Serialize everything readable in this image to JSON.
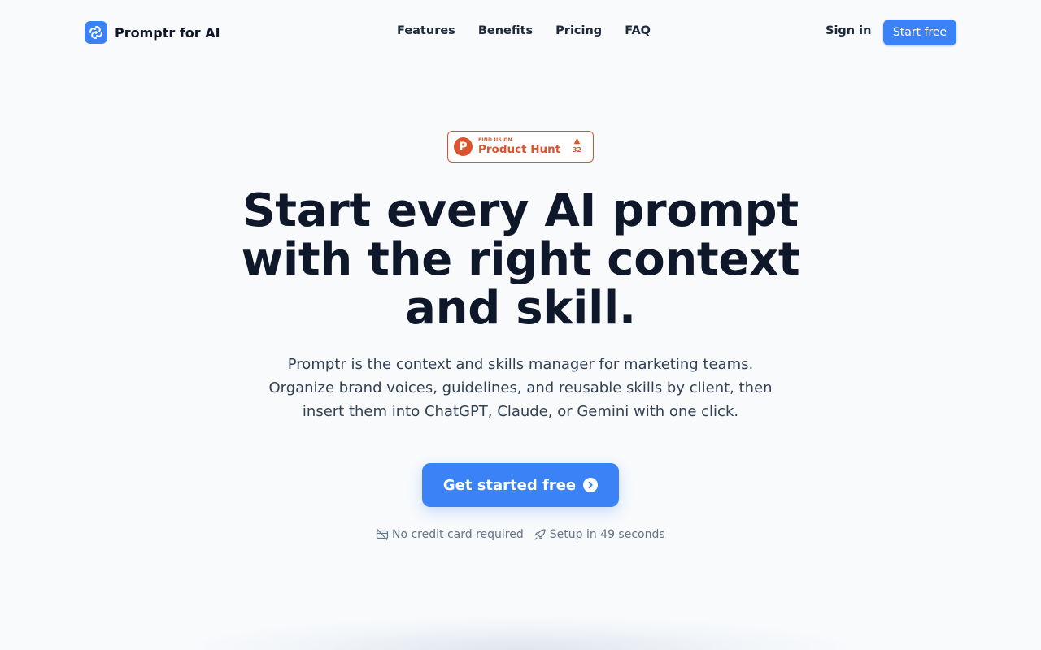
{
  "brand": {
    "name": "Promptr for AI",
    "icon": "swirl-logo-icon",
    "color": "#3b82f6"
  },
  "nav": {
    "links": [
      {
        "label": "Features"
      },
      {
        "label": "Benefits"
      },
      {
        "label": "Pricing"
      },
      {
        "label": "FAQ"
      }
    ],
    "sign_in": "Sign in",
    "start_free": "Start free"
  },
  "product_hunt": {
    "small_label": "FIND US ON",
    "name": "Product Hunt",
    "logo_letter": "P",
    "votes": "32",
    "color": "#da552f"
  },
  "hero": {
    "headline": "Start every AI prompt with the right context and skill.",
    "subtext": "Promptr is the context and skills manager for marketing teams. Organize brand voices, guidelines, and reusable skills by client, then insert them into ChatGPT, Claude, or Gemini with one click.",
    "cta_label": "Get started free",
    "notes": [
      {
        "icon": "credit-card-off-icon",
        "text": "No credit card required"
      },
      {
        "icon": "rocket-icon",
        "text": "Setup in 49 seconds"
      }
    ]
  },
  "colors": {
    "accent": "#3b82f6",
    "heading": "#0f172a",
    "body": "#334155",
    "muted": "#64748b",
    "background": "#f8fafc"
  }
}
